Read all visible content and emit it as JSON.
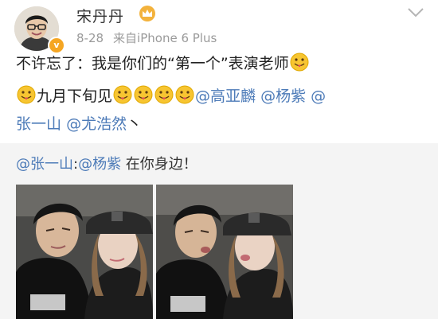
{
  "post": {
    "username": "宋丹丹",
    "date": "8-28",
    "source": "来自iPhone 6 Plus",
    "verified_badge": "v",
    "line1_text": "不许忘了：我是你们的“第一个”表演老师",
    "line2_text": "九月下旬见",
    "mentions_line2": [
      "@高亚麟",
      "@杨紫",
      "@"
    ],
    "mentions_line3": [
      "张一山",
      "@尤浩然"
    ],
    "line3_tail": "丶",
    "emoji_name": "tongue-out-emoji-icon"
  },
  "repost": {
    "mention1": "@张一山",
    "colon": ":",
    "mention2": "@杨紫",
    "text": " 在你身边！"
  },
  "icons": {
    "crown": "crown-icon",
    "dropdown": "chevron-down-icon"
  },
  "colors": {
    "mention": "#4d7bb8",
    "meta": "#9a9a9a",
    "repost_bg": "#f4f4f4",
    "badge": "#f5a623"
  }
}
